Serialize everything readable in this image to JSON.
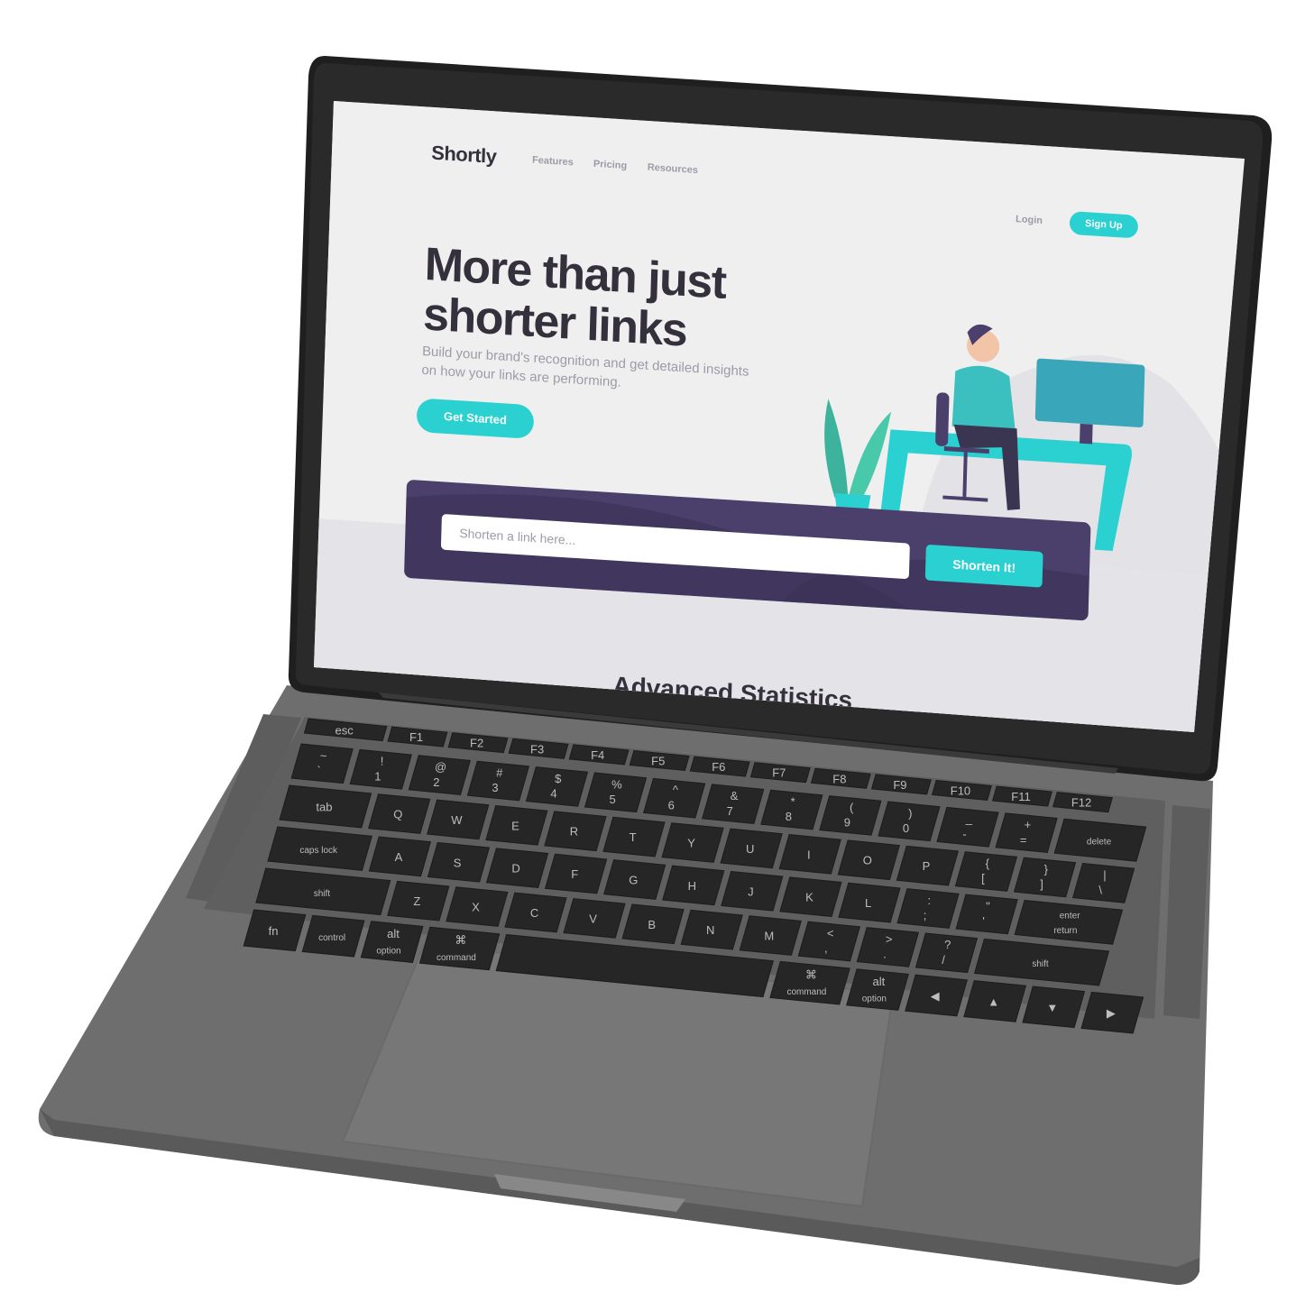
{
  "site": {
    "logo": "Shortly",
    "nav": {
      "features": "Features",
      "pricing": "Pricing",
      "resources": "Resources",
      "login": "Login",
      "signup": "Sign Up"
    },
    "hero": {
      "title_line1": "More than just",
      "title_line2": "shorter links",
      "subtitle": "Build your brand's recognition and get detailed insights on how your links are performing.",
      "cta": "Get Started"
    },
    "shorten": {
      "placeholder": "Shorten a link here...",
      "button": "Shorten It!"
    },
    "next_section_title": "Advanced Statistics"
  },
  "keyboard": {
    "row_fn": [
      "esc",
      "F1",
      "F2",
      "F3",
      "F4",
      "F5",
      "F6",
      "F7",
      "F8",
      "F9",
      "F10",
      "F11",
      "F12"
    ],
    "row_num": [
      "~\n`",
      "!\n1",
      "@\n2",
      "#\n3",
      "$\n4",
      "%\n5",
      "^\n6",
      "&\n7",
      "*\n8",
      "(\n9",
      ")\n0",
      "_\n-",
      "+\n=",
      "delete"
    ],
    "row_q": [
      "tab",
      "Q",
      "W",
      "E",
      "R",
      "T",
      "Y",
      "U",
      "I",
      "O",
      "P",
      "{\n[",
      "}\n]",
      "|\n\\"
    ],
    "row_a": [
      "caps lock",
      "A",
      "S",
      "D",
      "F",
      "G",
      "H",
      "J",
      "K",
      "L",
      ":\n;",
      "\"\n'",
      "enter\nreturn"
    ],
    "row_z": [
      "shift",
      "Z",
      "X",
      "C",
      "V",
      "B",
      "N",
      "M",
      "<\n,",
      ">\n.",
      "?\n/",
      "shift"
    ],
    "row_bottom": [
      "fn",
      "control",
      "alt\noption",
      "⌘\ncommand",
      "",
      "⌘\ncommand",
      "alt\noption",
      "◀",
      "▲",
      "▼",
      "▶"
    ]
  },
  "colors": {
    "cyan": "#2bd0d0",
    "dark_violet": "#4b3f6b",
    "text_dark": "#34313d",
    "gray": "#9e9aa7",
    "laptop_body": "#6b6b6b",
    "key": "#2b2b2b"
  }
}
